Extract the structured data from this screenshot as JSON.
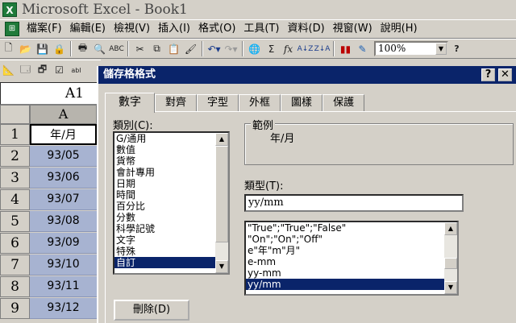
{
  "window": {
    "title": "Microsoft Excel - Book1"
  },
  "menu": {
    "items": [
      "檔案(F)",
      "編輯(E)",
      "檢視(V)",
      "插入(I)",
      "格式(O)",
      "工具(T)",
      "資料(D)",
      "視窗(W)",
      "說明(H)"
    ]
  },
  "toolbar": {
    "zoom_value": "100%",
    "icons": [
      "new-icon",
      "open-icon",
      "save-icon",
      "permission-icon",
      "print-icon",
      "print-preview-icon",
      "spelling-icon",
      "cut-icon",
      "copy-icon",
      "paste-icon",
      "format-painter-icon",
      "undo-icon",
      "redo-icon",
      "hyperlink-icon",
      "autosum-icon",
      "function-icon",
      "sort-ascending-icon",
      "sort-descending-icon",
      "chart-wizard-icon",
      "drawing-icon"
    ]
  },
  "namebox": {
    "value": "A1"
  },
  "sheet": {
    "column_header": "A",
    "rows": [
      {
        "num": "1",
        "value": "年/月"
      },
      {
        "num": "2",
        "value": "93/05"
      },
      {
        "num": "3",
        "value": "93/06"
      },
      {
        "num": "4",
        "value": "93/07"
      },
      {
        "num": "5",
        "value": "93/08"
      },
      {
        "num": "6",
        "value": "93/09"
      },
      {
        "num": "7",
        "value": "93/10"
      },
      {
        "num": "8",
        "value": "93/11"
      },
      {
        "num": "9",
        "value": "93/12"
      }
    ]
  },
  "dialog": {
    "title": "儲存格格式",
    "help_btn": "?",
    "close_btn": "✕",
    "tabs": [
      "數字",
      "對齊",
      "字型",
      "外框",
      "圖樣",
      "保護"
    ],
    "category_label": "類別(C):",
    "categories": [
      "G/通用",
      "數值",
      "貨幣",
      "會計專用",
      "日期",
      "時間",
      "百分比",
      "分數",
      "科學記號",
      "文字",
      "特殊",
      "自訂"
    ],
    "selected_category": "自訂",
    "sample_label": "範例",
    "sample_value": "年/月",
    "type_label": "類型(T):",
    "type_value": "yy/mm",
    "type_list": [
      "\"True\";\"True\";\"False\"",
      "\"On\";\"On\";\"Off\"",
      "e\"年\"m\"月\"",
      "e-mm",
      "yy-mm",
      "yy/mm"
    ],
    "selected_type": "yy/mm",
    "delete_button": "刪除(D)"
  }
}
